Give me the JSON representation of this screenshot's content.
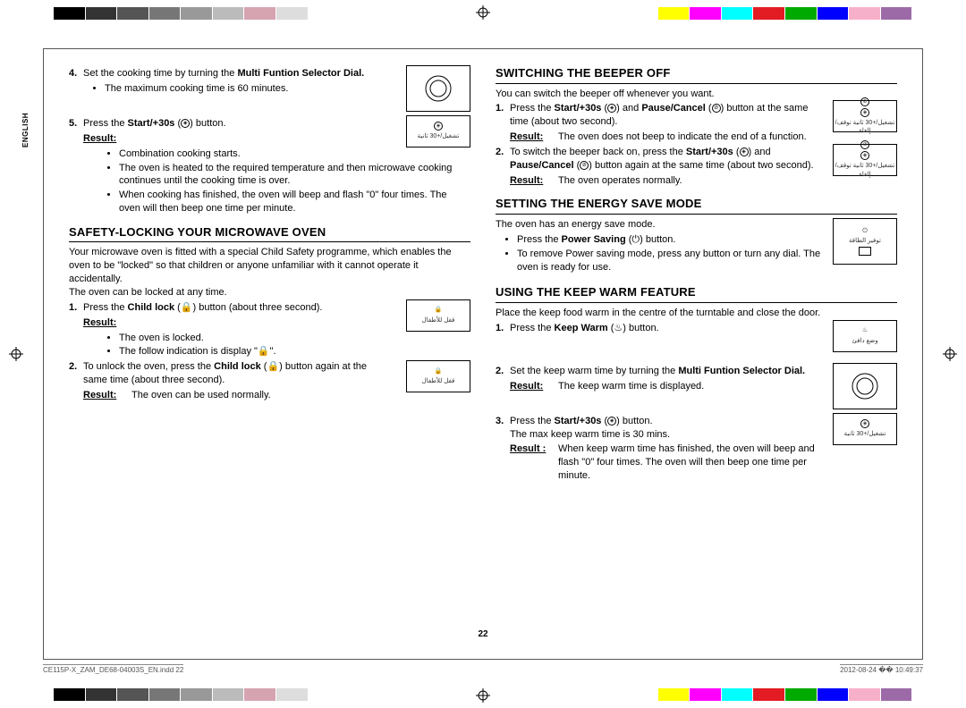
{
  "colorbar_top": [
    "#000",
    "#333",
    "#555",
    "#777",
    "#999",
    "#bbb",
    "#d6a3b1",
    "#ddd",
    "#fff",
    "#fff",
    "#fff",
    "#fff",
    "#fff",
    "#fff",
    "#fff",
    "#fff",
    "#fff",
    "#fff",
    "#fff",
    "#ff0",
    "#f0f",
    "#0ff",
    "#e31b23",
    "#0a0",
    "#00f",
    "#f7b0c9",
    "#9d6aa8"
  ],
  "colorbar_bottom": [
    "#000",
    "#333",
    "#555",
    "#777",
    "#999",
    "#bbb",
    "#d6a3b1",
    "#ddd",
    "#fff",
    "#fff",
    "#fff",
    "#fff",
    "#fff",
    "#fff",
    "#fff",
    "#fff",
    "#fff",
    "#fff",
    "#fff",
    "#ff0",
    "#f0f",
    "#0ff",
    "#e31b23",
    "#0a0",
    "#00f",
    "#f7b0c9",
    "#9d6aa8"
  ],
  "side_tab": "ENGLISH",
  "left": {
    "step4_num": "4.",
    "step4_body_pre": "Set the cooking time by turning the ",
    "step4_body_bold": "Multi Funtion Selector Dial.",
    "step4_bullet": "The maximum cooking time is 60 minutes.",
    "step5_num": "5.",
    "step5_body_pre": "Press the ",
    "step5_body_bold": "Start/+30s",
    "step5_body_post": " button.",
    "step5_result_label": "Result:",
    "step5_result_b1": "Combination cooking starts.",
    "step5_result_b2": "The oven is heated to the required temperature and then microwave cooking continues until the cooking time is over.",
    "step5_result_b3": "When cooking has finished, the oven will beep and flash \"0\" four times. The oven will then beep one time per minute.",
    "h_safety": "SAFETY-LOCKING YOUR MICROWAVE OVEN",
    "safety_intro": "Your microwave oven is fitted with a special Child Safety programme, which enables the oven to be \"locked\" so that children or anyone unfamiliar with it cannot operate it accidentally.",
    "safety_anytime": "The oven can be locked at any time.",
    "lock1_num": "1.",
    "lock1_pre": "Press the ",
    "lock1_bold": "Child lock",
    "lock1_post": " button (about three second).",
    "lock1_result_label": "Result:",
    "lock1_result_b1": "The oven is locked.",
    "lock1_result_b2": "The follow indication is display \"🔒\".",
    "lock2_num": "2.",
    "lock2_pre": "To unlock the oven, press the ",
    "lock2_bold": "Child lock",
    "lock2_post": " button again at the same time (about three second).",
    "lock2_result_label": "Result:",
    "lock2_result_text": "The oven can be used normally."
  },
  "right": {
    "h_beeper": "SWITCHING THE BEEPER OFF",
    "beeper_intro": "You can switch the beeper off whenever you want.",
    "beep1_num": "1.",
    "beep1_pre": "Press the ",
    "beep1_b1": "Start/+30s",
    "beep1_mid": " and ",
    "beep1_b2": "Pause/Cancel",
    "beep1_post": " button at the same time (about two second).",
    "beep1_result_label": "Result:",
    "beep1_result_text": "The oven does not beep to indicate the end of a function.",
    "beep2_num": "2.",
    "beep2_pre": "To switch the beeper back on, press the ",
    "beep2_b1": "Start/+30s",
    "beep2_mid": " and ",
    "beep2_b2": "Pause/Cancel",
    "beep2_post": " button again at the same time (about two second).",
    "beep2_result_label": "Result:",
    "beep2_result_text": "The oven operates normally.",
    "h_energy": "SETTING THE ENERGY SAVE MODE",
    "energy_intro": "The oven has an energy save mode.",
    "energy_b1_pre": "Press the ",
    "energy_b1_bold": "Power Saving",
    "energy_b1_post": " button.",
    "energy_b2": "To remove Power saving mode, press any button or turn any dial. The oven is ready for use.",
    "h_keepwarm": "USING THE KEEP WARM FEATURE",
    "kw_intro": "Place the keep food warm in the centre of the turntable and close the door.",
    "kw1_num": "1.",
    "kw1_pre": "Press the ",
    "kw1_bold": "Keep Warm",
    "kw1_post": " button.",
    "kw2_num": "2.",
    "kw2_pre": "Set the keep warm time by turning the ",
    "kw2_bold": "Multi Funtion Selector Dial.",
    "kw2_result_label": "Result:",
    "kw2_result_text": "The keep warm time is displayed.",
    "kw3_num": "3.",
    "kw3_pre": "Press the ",
    "kw3_bold": "Start/+30s",
    "kw3_post": " button.",
    "kw3_line2": "The max keep warm time is 30 mins.",
    "kw3_result_label": "Result :",
    "kw3_result_text": "When keep warm time has finished, the oven will beep and flash \"0\" four times. The oven will then beep one time per minute."
  },
  "page_number": "22",
  "footer_file": "CE115P-X_ZAM_DE68-04003S_EN.indd   22",
  "footer_date": "2012-08-24   �� 10:49:37",
  "figs": {
    "dial": "⟳",
    "start30": "تشغيل/+30 ثانية",
    "lock": "قفل للأطفال",
    "pause_both": "تشغيل/+30 ثانية   توقف/إلغاء",
    "powersave": "توفير الطاقة",
    "keepwarm": "وضع دافئ"
  }
}
